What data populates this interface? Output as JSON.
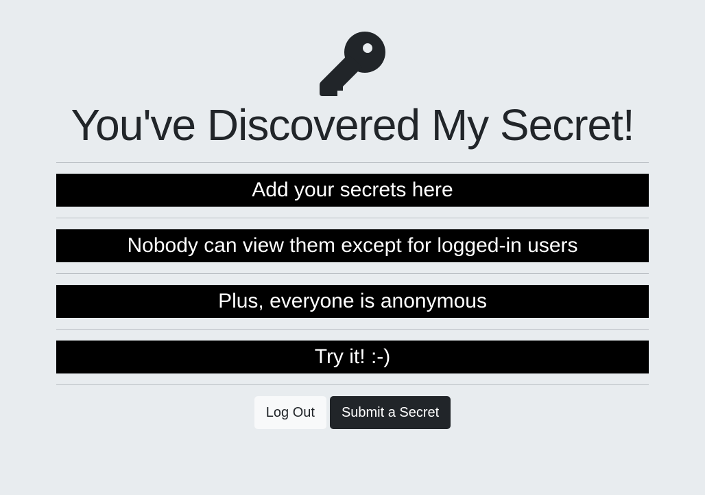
{
  "header": {
    "icon": "key-icon",
    "title": "You've Discovered My Secret!"
  },
  "secrets": [
    "Add your secrets here",
    "Nobody can view them except for logged-in users",
    "Plus, everyone is anonymous",
    "Try it! :-)"
  ],
  "actions": {
    "logout_label": "Log Out",
    "submit_label": "Submit a Secret"
  },
  "colors": {
    "background": "#e8ecef",
    "secret_background": "#000000",
    "secret_text": "#ffffff",
    "dark_button": "#212529",
    "light_button": "#f8f9fa"
  }
}
